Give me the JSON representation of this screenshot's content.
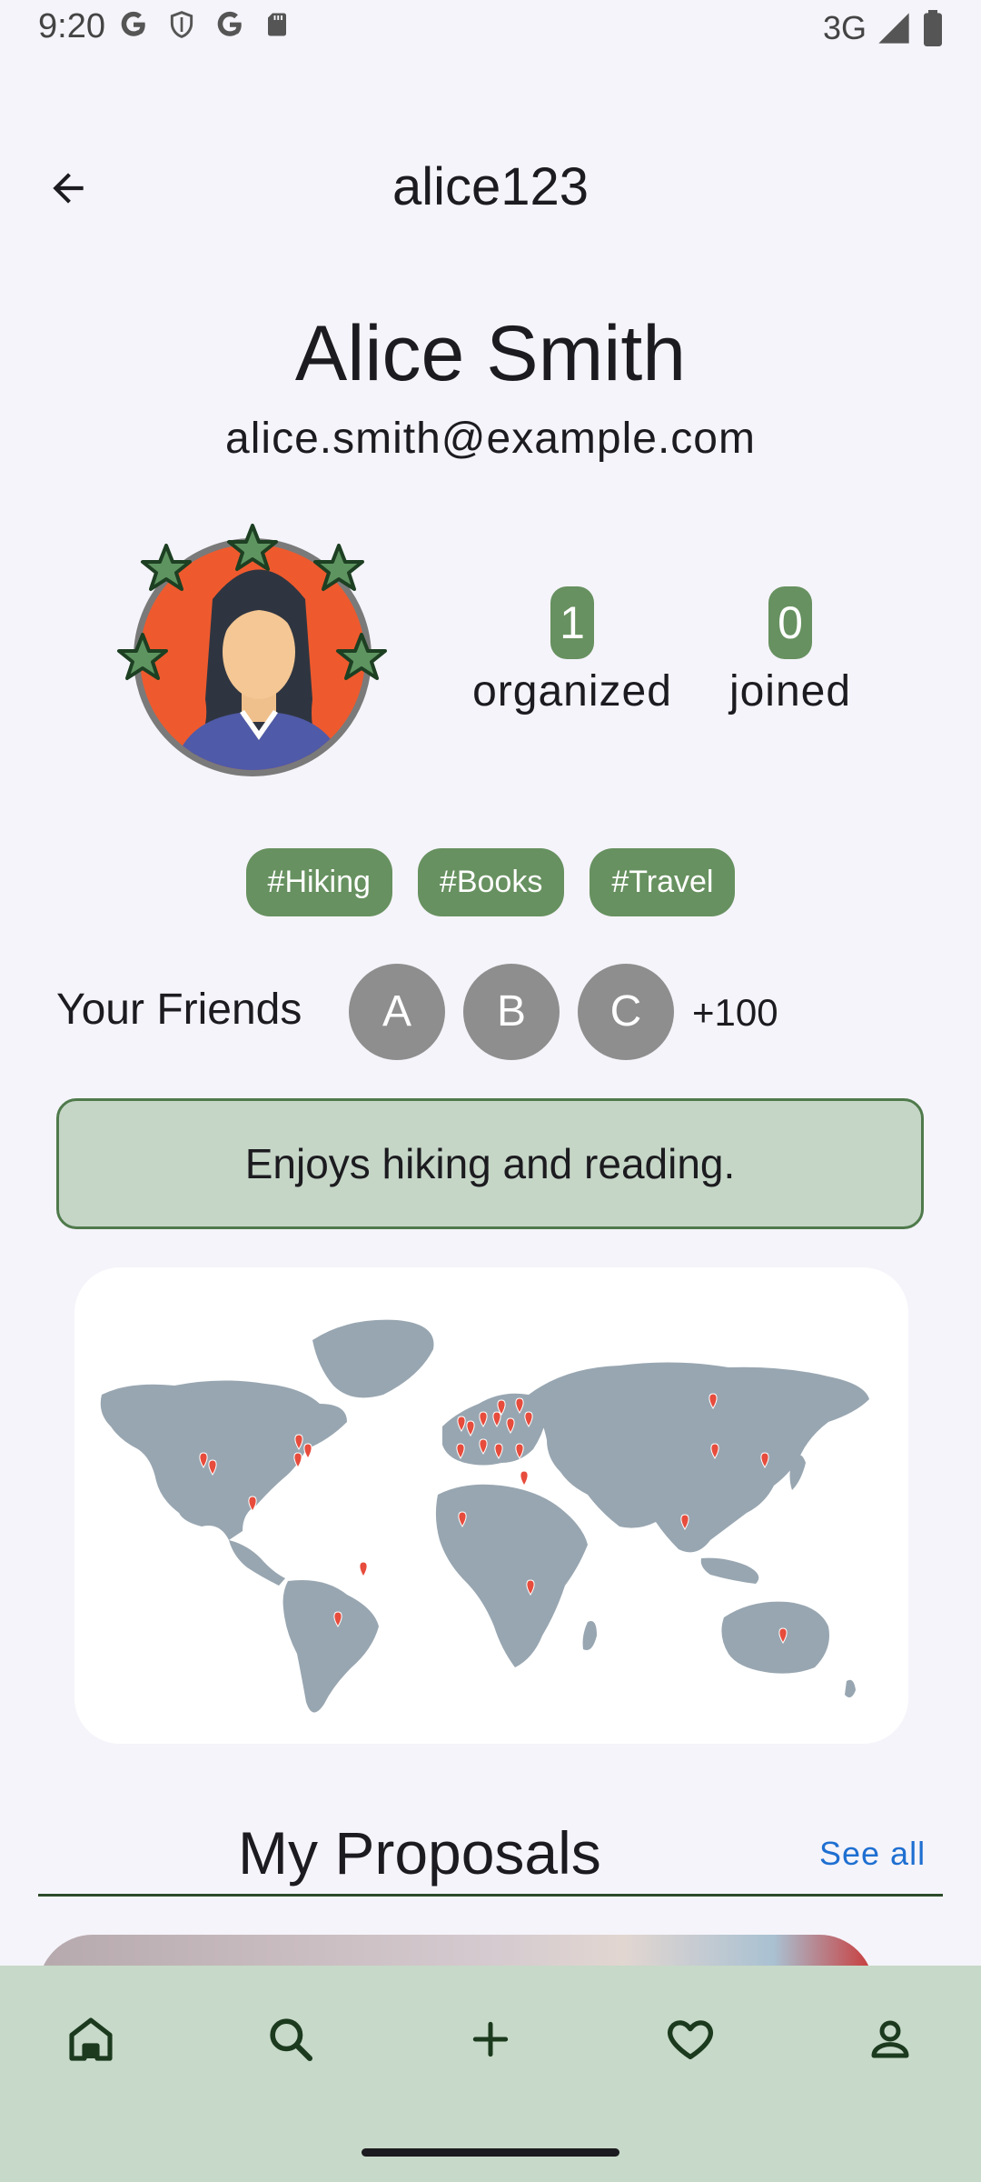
{
  "status_bar": {
    "time": "9:20",
    "network": "3G",
    "icons_left": [
      "google-icon",
      "shield-icon",
      "google-icon",
      "sd-card-icon"
    ],
    "icons_right": [
      "signal-icon",
      "battery-icon"
    ]
  },
  "header": {
    "title": "alice123",
    "back_icon": "arrow-left-icon"
  },
  "profile": {
    "name": "Alice Smith",
    "email": "alice.smith@example.com",
    "avatar_icon": "woman-avatar-icon",
    "stats": [
      {
        "value": "1",
        "label": "organized"
      },
      {
        "value": "0",
        "label": "joined"
      }
    ],
    "tags": [
      "#Hiking",
      "#Books",
      "#Travel"
    ]
  },
  "friends": {
    "label": "Your Friends",
    "avatars": [
      "A",
      "B",
      "C"
    ],
    "more": "+100"
  },
  "bio": "Enjoys hiking and reading.",
  "map": {
    "icon": "world-map-icon",
    "marker_color": "#e74c3c",
    "land_color": "#98a6b1"
  },
  "proposals": {
    "title": "My Proposals",
    "see_all": "See all"
  },
  "bottom_nav": {
    "items": [
      "home-icon",
      "search-icon",
      "plus-icon",
      "heart-icon",
      "person-icon"
    ]
  },
  "colors": {
    "accent_green": "#679160",
    "bio_bg": "#c5d6c7",
    "nav_bg": "#c7d9c8",
    "link_blue": "#1f6fd1"
  }
}
